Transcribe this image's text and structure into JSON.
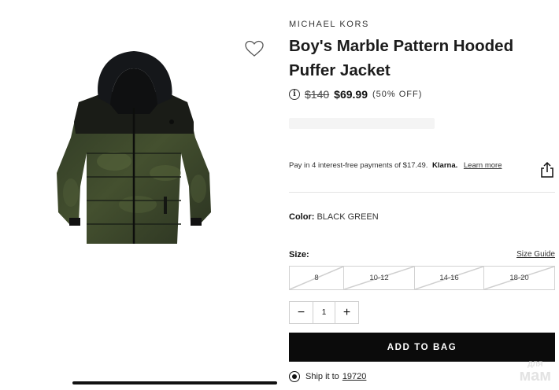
{
  "product": {
    "brand": "MICHAEL KORS",
    "title": "Boy's Marble Pattern Hooded Puffer Jacket",
    "original_price": "$140",
    "sale_price": "$69.99",
    "discount": "(50% OFF)"
  },
  "klarna": {
    "text": "Pay in 4 interest-free payments of $17.49.",
    "brand": "Klarna.",
    "link": "Learn more"
  },
  "color": {
    "label": "Color:",
    "value": "BLACK GREEN"
  },
  "size": {
    "label": "Size:",
    "guide": "Size Guide",
    "options": [
      {
        "label": "8",
        "available": false
      },
      {
        "label": "10-12",
        "available": false
      },
      {
        "label": "14-16",
        "available": false
      },
      {
        "label": "18-20",
        "available": false
      }
    ]
  },
  "quantity": {
    "value": "1",
    "minus": "−",
    "plus": "+"
  },
  "add_to_bag": "ADD TO BAG",
  "shipping": {
    "label": "Ship it to",
    "zip": "19720"
  },
  "watermark": {
    "small": "ДЛЯ",
    "big": "мам"
  },
  "icons": {
    "wishlist": "heart-icon",
    "info": "info-icon",
    "share": "share-icon"
  },
  "colors": {
    "primary_button": "#0b0b0b",
    "text": "#1a1a1a",
    "jacket_dark": "#1c1f17",
    "jacket_green": "#3c4a2c"
  }
}
